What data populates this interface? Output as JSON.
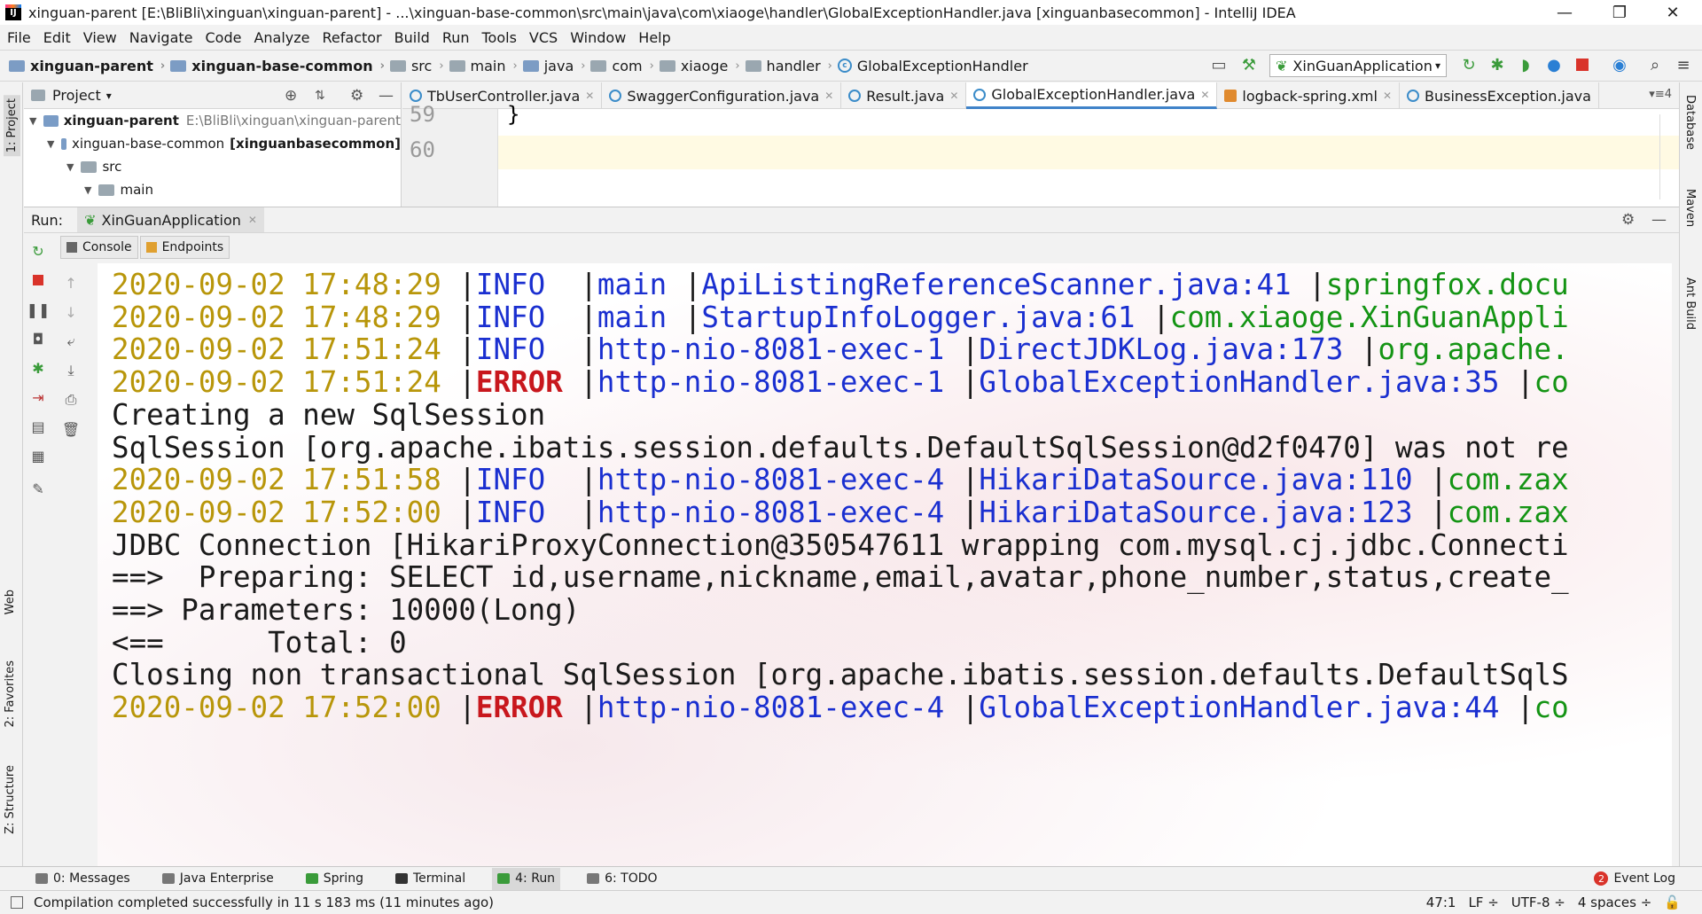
{
  "window": {
    "title": "xinguan-parent [E:\\BliBli\\xinguan\\xinguan-parent] - ...\\xinguan-base-common\\src\\main\\java\\com\\xiaoge\\handler\\GlobalExceptionHandler.java [xinguanbasecommon] - IntelliJ IDEA",
    "minimize": "—",
    "maximize": "❐",
    "close": "✕"
  },
  "menu": [
    "File",
    "Edit",
    "View",
    "Navigate",
    "Code",
    "Analyze",
    "Refactor",
    "Build",
    "Run",
    "Tools",
    "VCS",
    "Window",
    "Help"
  ],
  "breadcrumb": [
    "xinguan-parent",
    "xinguan-base-common",
    "src",
    "main",
    "java",
    "com",
    "xiaoge",
    "handler",
    "GlobalExceptionHandler"
  ],
  "toolbar": {
    "run_config": "XinGuanApplication"
  },
  "left_strip": {
    "project": "1: Project",
    "web": "Web",
    "favorites": "2: Favorites",
    "structure": "Z: Structure"
  },
  "right_strip": {
    "database": "Database",
    "maven": "Maven",
    "ant": "Ant Build"
  },
  "project_panel": {
    "title": "Project",
    "tree": [
      {
        "name": "xinguan-parent",
        "path": "E:\\BliBli\\xinguan\\xinguan-parent"
      },
      {
        "name": "xinguan-base-common",
        "path": "[xinguanbasecommon]"
      },
      {
        "name": "src"
      },
      {
        "name": "main"
      }
    ]
  },
  "editor": {
    "tabs": [
      {
        "label": "TbUserController.java",
        "active": false
      },
      {
        "label": "SwaggerConfiguration.java",
        "active": false
      },
      {
        "label": "Result.java",
        "active": false
      },
      {
        "label": "GlobalExceptionHandler.java",
        "active": true
      },
      {
        "label": "logback-spring.xml",
        "active": false
      },
      {
        "label": "BusinessException.java",
        "active": false
      }
    ],
    "tab_count": "4",
    "lines": [
      {
        "no": "59",
        "code": "}"
      },
      {
        "no": "60",
        "code": ""
      }
    ]
  },
  "run_panel": {
    "label": "Run:",
    "tab": "XinGuanApplication",
    "console_tab": "Console",
    "endpoints_tab": "Endpoints"
  },
  "console": {
    "lines": [
      {
        "kind": "log",
        "date": "2020-09-02 17:48:29",
        "level": "INFO",
        "thread": "main",
        "source": "ApiListingReferenceScanner.java:41",
        "logger": "springfox.docu"
      },
      {
        "kind": "log",
        "date": "2020-09-02 17:48:29",
        "level": "INFO",
        "thread": "main",
        "source": "StartupInfoLogger.java:61",
        "logger": "com.xiaoge.XinGuanAppli"
      },
      {
        "kind": "log",
        "date": "2020-09-02 17:51:24",
        "level": "INFO",
        "thread": "http-nio-8081-exec-1",
        "source": "DirectJDKLog.java:173",
        "logger": "org.apache."
      },
      {
        "kind": "log",
        "date": "2020-09-02 17:51:24",
        "level": "ERROR",
        "thread": "http-nio-8081-exec-1",
        "source": "GlobalExceptionHandler.java:35",
        "logger": "co"
      },
      {
        "kind": "text",
        "text": "Creating a new SqlSession"
      },
      {
        "kind": "text",
        "text": "SqlSession [org.apache.ibatis.session.defaults.DefaultSqlSession@d2f0470] was not re"
      },
      {
        "kind": "log",
        "date": "2020-09-02 17:51:58",
        "level": "INFO",
        "thread": "http-nio-8081-exec-4",
        "source": "HikariDataSource.java:110",
        "logger": "com.zax"
      },
      {
        "kind": "log",
        "date": "2020-09-02 17:52:00",
        "level": "INFO",
        "thread": "http-nio-8081-exec-4",
        "source": "HikariDataSource.java:123",
        "logger": "com.zax"
      },
      {
        "kind": "text",
        "text": "JDBC Connection [HikariProxyConnection@350547611 wrapping com.mysql.cj.jdbc.Connecti"
      },
      {
        "kind": "text",
        "text": "==>  Preparing: SELECT id,username,nickname,email,avatar,phone_number,status,create_"
      },
      {
        "kind": "text",
        "text": "==> Parameters: 10000(Long)"
      },
      {
        "kind": "text",
        "text": "<==      Total: 0"
      },
      {
        "kind": "text",
        "text": "Closing non transactional SqlSession [org.apache.ibatis.session.defaults.DefaultSqlS"
      },
      {
        "kind": "log",
        "date": "2020-09-02 17:52:00",
        "level": "ERROR",
        "thread": "http-nio-8081-exec-4",
        "source": "GlobalExceptionHandler.java:44",
        "logger": "co"
      }
    ]
  },
  "bottom_tabs": [
    "0: Messages",
    "Java Enterprise",
    "Spring",
    "Terminal",
    "4: Run",
    "6: TODO"
  ],
  "event_log": {
    "count": "2",
    "label": "Event Log"
  },
  "status": {
    "message": "Compilation completed successfully in 11 s 183 ms (11 minutes ago)",
    "position": "47:1",
    "line_sep": "LF ÷",
    "encoding": "UTF-8 ÷",
    "indent": "4 spaces ÷"
  },
  "colors": {
    "date": "#b8960a",
    "info": "#1a2fd0",
    "error": "#c8171d",
    "logger": "#149414",
    "accent": "#4083c9"
  }
}
